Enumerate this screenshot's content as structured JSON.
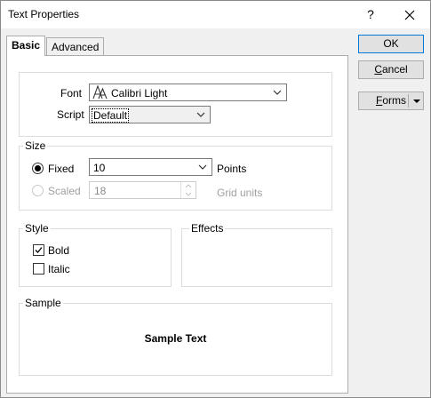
{
  "window": {
    "title": "Text Properties",
    "help_glyph": "?",
    "close_glyph": "✕"
  },
  "tabs": [
    {
      "label": "Basic",
      "active": true
    },
    {
      "label": "Advanced",
      "active": false
    }
  ],
  "font_group": {
    "font_label": "Font",
    "font_value": "Calibri Light",
    "script_label": "Script",
    "script_value": "Default"
  },
  "size_group": {
    "title": "Size",
    "fixed_label": "Fixed",
    "fixed_selected": true,
    "fixed_value": "10",
    "fixed_unit": "Points",
    "scaled_label": "Scaled",
    "scaled_value": "18",
    "scaled_unit": "Grid units"
  },
  "style_group": {
    "title": "Style",
    "bold_label": "Bold",
    "bold_checked": true,
    "italic_label": "Italic",
    "italic_checked": false
  },
  "effects_group": {
    "title": "Effects"
  },
  "sample_group": {
    "title": "Sample",
    "text": "Sample Text"
  },
  "buttons": {
    "ok": "OK",
    "cancel_mnemonic": "C",
    "cancel_rest": "ancel",
    "forms_mnemonic": "F",
    "forms_rest": "orms"
  },
  "colors": {
    "accent": "#0078d7"
  }
}
